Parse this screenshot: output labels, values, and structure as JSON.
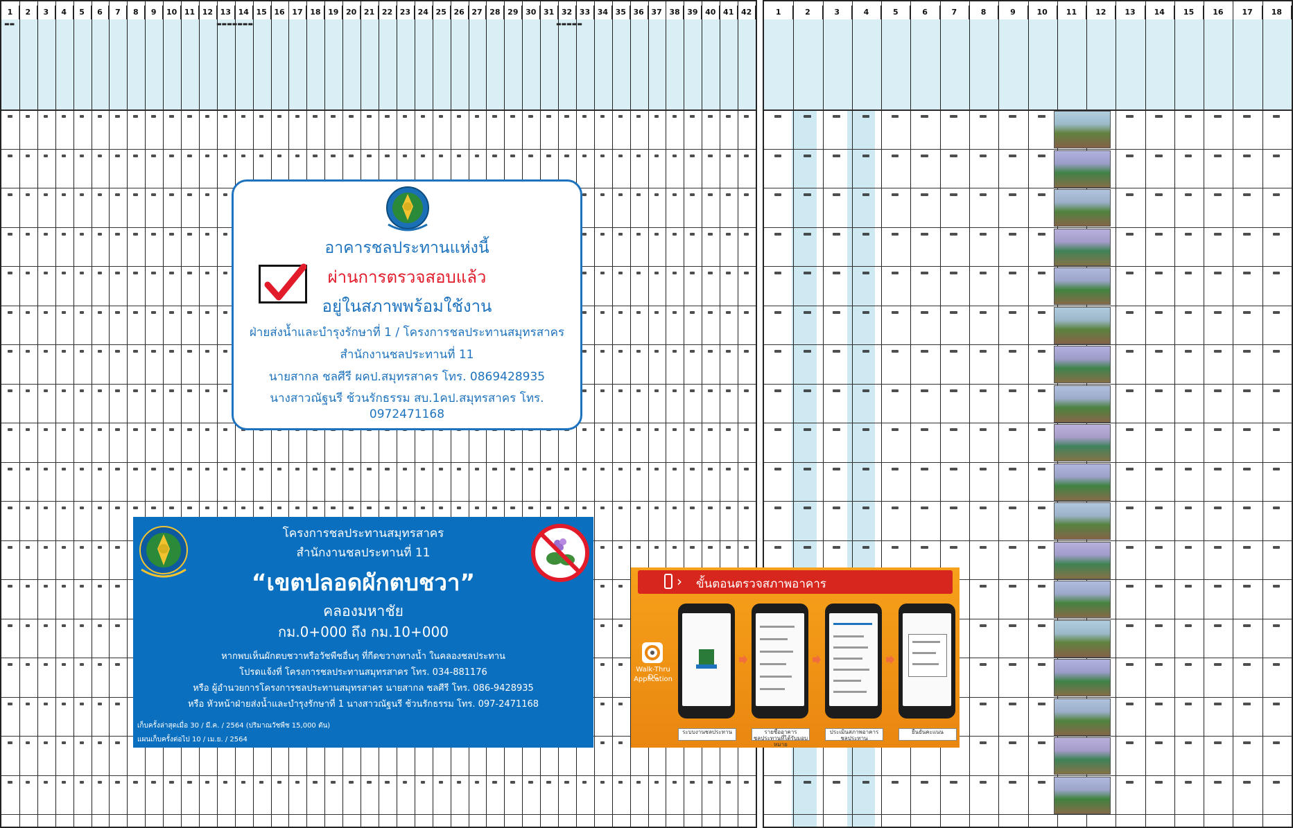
{
  "left_sheet": {
    "column_numbers": [
      "1",
      "2",
      "3",
      "4",
      "5",
      "6",
      "7",
      "8",
      "9",
      "10",
      "11",
      "12",
      "13",
      "14",
      "15",
      "16",
      "17",
      "18",
      "19",
      "20",
      "21",
      "22",
      "23",
      "24",
      "25",
      "26",
      "27",
      "28",
      "29",
      "30",
      "31",
      "32",
      "33",
      "34",
      "35",
      "36",
      "37",
      "38",
      "39",
      "40",
      "41",
      "42"
    ]
  },
  "right_sheet": {
    "column_numbers": [
      "1",
      "2",
      "3",
      "4",
      "5",
      "6",
      "7",
      "8",
      "9",
      "10",
      "11",
      "12",
      "13",
      "14",
      "15",
      "16",
      "17",
      "18"
    ]
  },
  "cert_card": {
    "line1": "อาคารชลประทานแห่งนี้",
    "line2": "ผ่านการตรวจสอบแล้ว",
    "line3": "อยู่ในสภาพพร้อมใช้งาน",
    "line4": "ฝ่ายส่งน้ำและบำรุงรักษาที่ 1 / โครงการชลประทานสมุทรสาคร",
    "line5": "สำนักงานชลประทานที่ 11",
    "line6": "นายสากล ชลศีรี ผคป.สมุทรสาคร โทร. 0869428935",
    "line7": "นางสาวณัฐนรี ช้วนรักธรรม สบ.1คป.สมุทรสาคร โทร. 0972471168",
    "colors": {
      "blue": "#1e73be",
      "red": "#e21b2b"
    }
  },
  "sign_card": {
    "line1": "โครงการชลประทานสมุทรสาคร",
    "line2": "สำนักงานชลประทานที่ 11",
    "headline": "“เขตปลอดผักตบชวา”",
    "canal": "คลองมหาชัย",
    "range": "กม.0+000  ถึง  กม.10+000",
    "info1": "หากพบเห็นผักตบชวาหรือวัชพืชอื่นๆ ที่กีดขวางทางน้ำ ในคลองชลประทาน",
    "info2": "โปรดแจ้งที่ โครงการชลประทานสมุทรสาคร โทร. 034-881176",
    "info3": "หรือ ผู้อำนวยการโครงการชลประทานสมุทรสาคร นายสากล ชลศีรี โทร. 086-9428935",
    "info4": "หรือ หัวหน้าฝ่ายส่งน้ำและบำรุงรักษาที่ 1 นางสาวณัฐนรี ช้วนรักธรรม โทร. 097-2471168",
    "footer1": "เก็บครั้งล่าสุดเมื่อ  30  /  มี.ค.  /  2564   (ปริมาณวัชพืช 15,000 ตัน)",
    "footer2": "แผนเก็บครั้งต่อไป  10  /  เม.ย.  /  2564",
    "colors": {
      "background": "#0b6fbf"
    }
  },
  "app_panel": {
    "title": "ขั้นตอนตรวจสภาพอาคาร",
    "app_name_1": "Walk-Thru DC",
    "app_name_2": "Application",
    "steps": [
      "ระบบงานชลประทาน",
      "รายชื่ออาคารชลประทานที่ได้รับมอบหมาย",
      "ประเมินสภาพอาคารชลประทาน",
      "ยืนยันคะแนน"
    ],
    "colors": {
      "bar": "#d7261e",
      "panel": "#f7a11b"
    }
  }
}
